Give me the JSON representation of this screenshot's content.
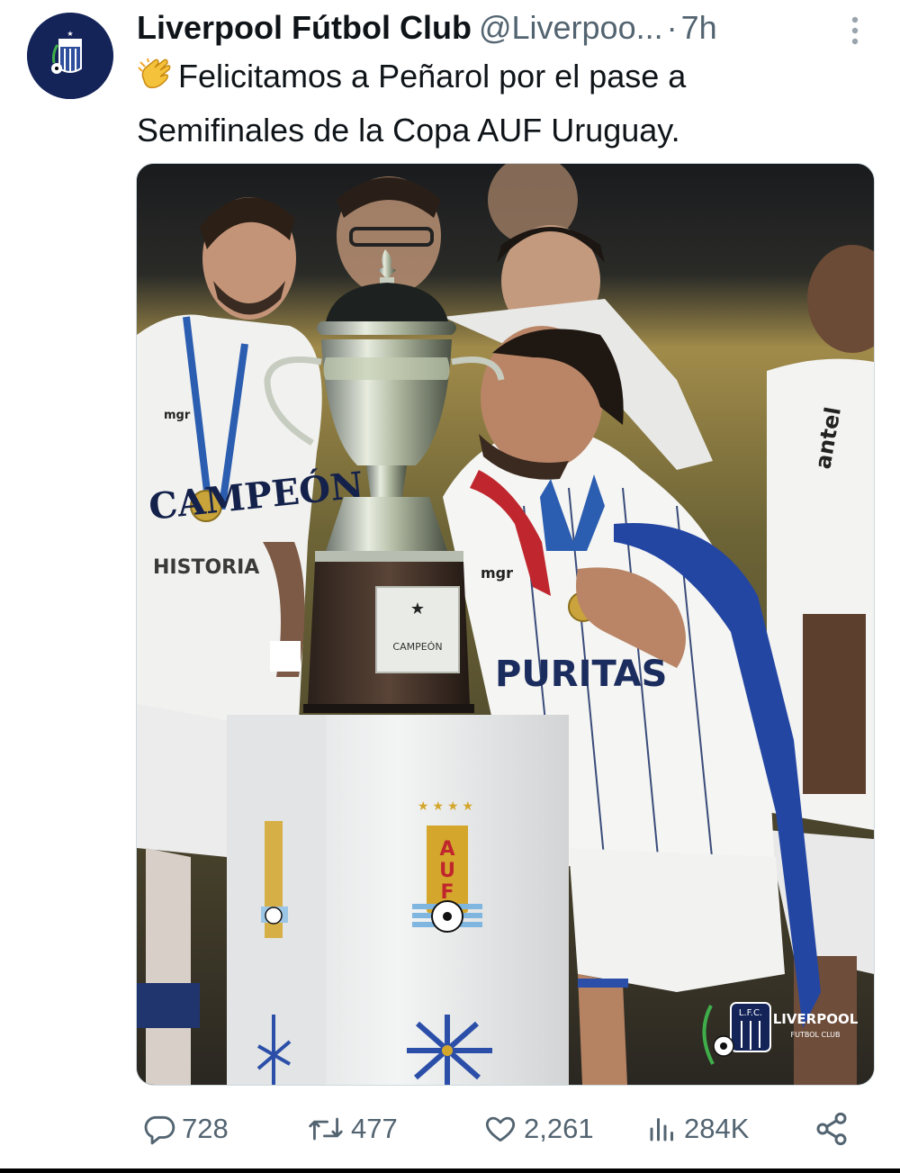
{
  "post": {
    "author_name": "Liverpool Fútbol Club",
    "author_handle": "@Liverpoo...",
    "separator": "·",
    "time_ago": "7h",
    "text_line1": "Felicitamos a Peñarol por el pase a",
    "text_line2": "Semifinales de la Copa AUF Uruguay.",
    "emoji_icon": "clapping-hands-icon"
  },
  "photo": {
    "jersey_sponsor": "PURITAS",
    "kit_brand": "mgr",
    "side_sponsor": "antel",
    "shirt_slogan_top": "CAMPEÓN",
    "shirt_slogan_bottom": "HISTORIA",
    "trophy_plaque": "CAMPEÓN",
    "pedestal_letters": [
      "A",
      "U",
      "F"
    ],
    "watermark_monogram": "L.F.C.",
    "watermark_name": "LIVERPOOL",
    "watermark_sub": "FUTBOL CLUB"
  },
  "actions": {
    "replies": "728",
    "reposts": "477",
    "likes": "2,261",
    "views": "284K"
  },
  "colors": {
    "text": "#0f1419",
    "muted": "#536471",
    "club_navy": "#142459",
    "auf_gold": "#d4a72c"
  }
}
